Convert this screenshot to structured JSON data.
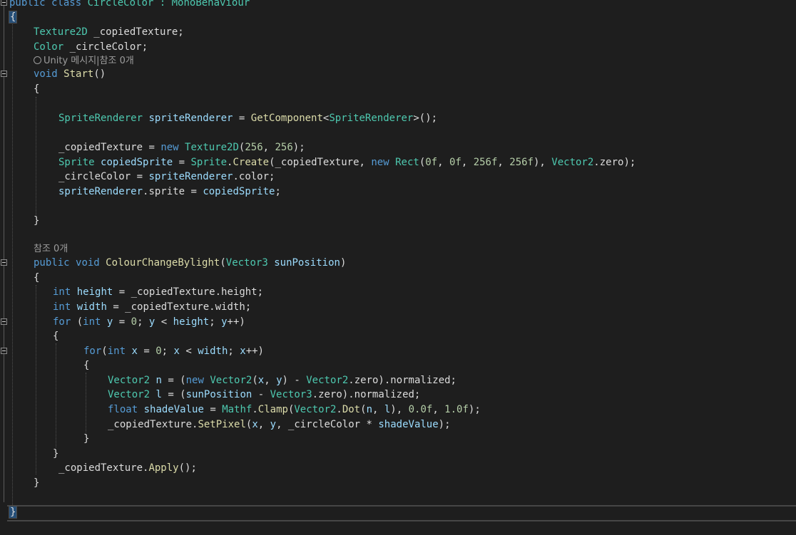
{
  "editor": {
    "language": "C#",
    "lines": {
      "l01": {
        "a": "public",
        "b": " ",
        "c": "class",
        "d": " CircleColor : ",
        "e": "MonoBehaviour"
      },
      "l02": "{",
      "l03": {
        "a": "Texture2D",
        "b": " _copiedTexture;"
      },
      "l04": {
        "a": "Color",
        "b": " _circleColor;"
      },
      "l05": "Unity 메시지|참조 0개",
      "l06": {
        "a": "void",
        "b": " ",
        "c": "Start",
        "d": "()"
      },
      "l07": "{",
      "l09": {
        "a": "SpriteRenderer",
        "b": " ",
        "c": "spriteRenderer",
        "d": " = ",
        "e": "GetComponent",
        "f": "<",
        "g": "SpriteRenderer",
        "h": ">();"
      },
      "l11": {
        "a": "_copiedTexture",
        "b": " = ",
        "c": "new",
        "d": " ",
        "e": "Texture2D",
        "f": "(",
        "g": "256",
        "h": ", ",
        "i": "256",
        "j": ");"
      },
      "l12": {
        "a": "Sprite",
        "b": " ",
        "c": "copiedSprite",
        "d": " = ",
        "e": "Sprite",
        "f": ".",
        "g": "Create",
        "h": "(_copiedTexture, ",
        "i": "new",
        "j": " ",
        "k": "Rect",
        "l": "(",
        "m": "0f",
        "n": ", ",
        "o": "0f",
        "p": ", ",
        "q": "256f",
        "r": ", ",
        "s": "256f",
        "t": "), ",
        "u": "Vector2",
        "v": ".zero);"
      },
      "l13": {
        "a": "_circleColor",
        "b": " = ",
        "c": "spriteRenderer",
        "d": ".color;"
      },
      "l14": {
        "a": "spriteRenderer",
        "b": ".sprite = ",
        "c": "copiedSprite",
        "d": ";"
      },
      "l16": "}",
      "l18": "참조 0개",
      "l19": {
        "a": "public",
        "b": " ",
        "c": "void",
        "d": " ",
        "e": "ColourChangeBylight",
        "f": "(",
        "g": "Vector3",
        "h": " ",
        "i": "sunPosition",
        "j": ")"
      },
      "l20": "{",
      "l21": {
        "a": "int",
        "b": " ",
        "c": "height",
        "d": " = _copiedTexture.height;"
      },
      "l22": {
        "a": "int",
        "b": " ",
        "c": "width",
        "d": " = _copiedTexture.width;"
      },
      "l23": {
        "a": "for",
        "b": " (",
        "c": "int",
        "d": " ",
        "e": "y",
        "f": " = ",
        "g": "0",
        "h": "; ",
        "i": "y",
        "j": " < ",
        "k": "height",
        "l": "; ",
        "m": "y",
        "n": "++)"
      },
      "l24": "{",
      "l25": {
        "a": "for",
        "b": "(",
        "c": "int",
        "d": " ",
        "e": "x",
        "f": " = ",
        "g": "0",
        "h": "; ",
        "i": "x",
        "j": " < ",
        "k": "width",
        "l": "; ",
        "m": "x",
        "n": "++)"
      },
      "l26": "{",
      "l27": {
        "a": "Vector2",
        "b": " ",
        "c": "n",
        "d": " = (",
        "e": "new",
        "f": " ",
        "g": "Vector2",
        "h": "(",
        "i": "x",
        "j": ", ",
        "k": "y",
        "l": ") - ",
        "m": "Vector2",
        "n": ".zero).normalized;"
      },
      "l28": {
        "a": "Vector2",
        "b": " ",
        "c": "l",
        "d": " = (",
        "e": "sunPosition",
        "f": " - ",
        "g": "Vector3",
        "h": ".zero).normalized;"
      },
      "l29": {
        "a": "float",
        "b": " ",
        "c": "shadeValue",
        "d": " = ",
        "e": "Mathf",
        "f": ".",
        "g": "Clamp",
        "h": "(",
        "i": "Vector2",
        "j": ".",
        "k": "Dot",
        "l": "(",
        "m": "n",
        "n": ", ",
        "o": "l",
        "p": "), ",
        "q": "0.0f",
        "r": ", ",
        "s": "1.0f",
        "t": ");"
      },
      "l30": {
        "a": "_copiedTexture",
        "b": ".",
        "c": "SetPixel",
        "d": "(",
        "e": "x",
        "f": ", ",
        "g": "y",
        "h": ", ",
        "i": "_circleColor",
        "j": " * ",
        "k": "shadeValue",
        "l": ");"
      },
      "l31": "}",
      "l32": "}",
      "l33": {
        "a": "_copiedTexture",
        "b": ".",
        "c": "Apply",
        "d": "();"
      },
      "l34": "}",
      "l36": "}"
    }
  },
  "colors": {
    "background": "#1e1e1e",
    "keyword": "#569cd6",
    "type": "#4ec9b0",
    "method": "#dcdcaa",
    "variable": "#9cdcfe",
    "number": "#b5cea8",
    "plain": "#dcdcdc",
    "codelens": "#9d9d9d"
  }
}
